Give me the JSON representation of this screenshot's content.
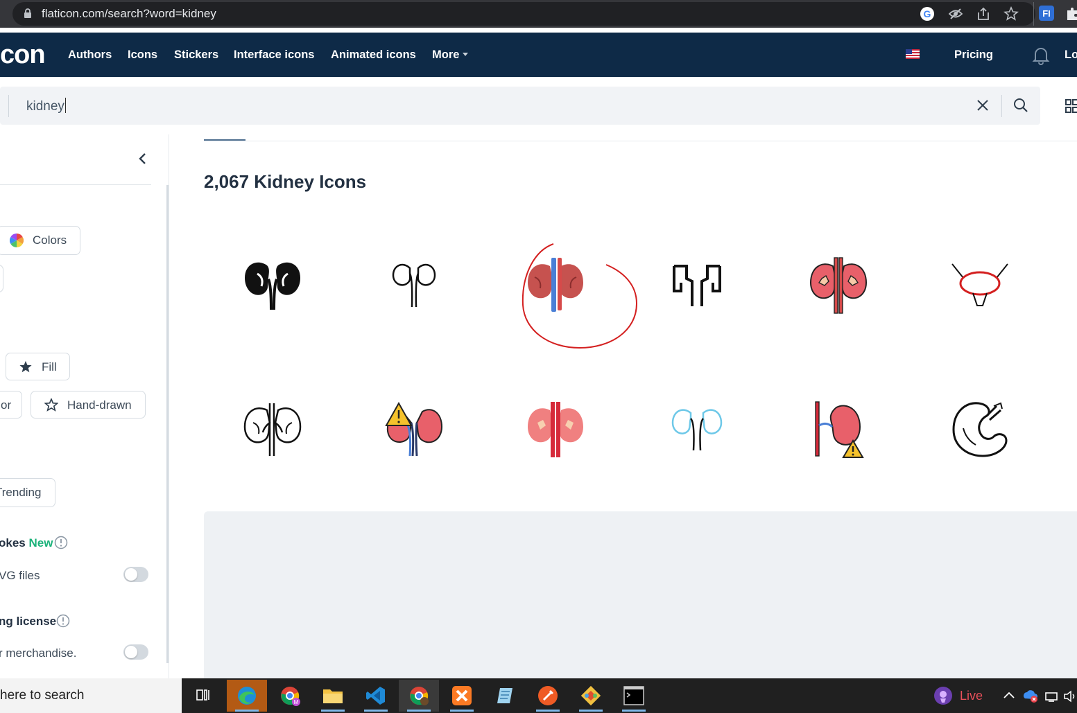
{
  "browser": {
    "url": "flaticon.com/search?word=kidney",
    "icons": [
      "google-icon",
      "eye-slash-icon",
      "share-icon",
      "star-icon",
      "flaticon-extension-icon",
      "puzzle-icon"
    ]
  },
  "header": {
    "logo_text": "con",
    "nav": [
      "Authors",
      "Icons",
      "Stickers",
      "Interface icons",
      "Animated icons",
      "More"
    ],
    "pricing_label": "Pricing",
    "login_label": "Lo"
  },
  "search": {
    "value": "kidney"
  },
  "sidebar": {
    "colors_label": "Colors",
    "fill_label": "Fill",
    "color_partial": "or",
    "handdrawn_label": "Hand-drawn",
    "trending_label": "Trending",
    "strokes_label": "okes",
    "new_badge": "New",
    "svg_label": "VG files",
    "license_label": "ng license",
    "merch_label": "r merchandise."
  },
  "main": {
    "results_title": "2,067 Kidney Icons",
    "icons": [
      "kidney-solid-black-icon",
      "kidney-outline-thin-icon",
      "kidney-red-blue-icon",
      "kidney-bold-outline-icon",
      "kidney-red-detailed-icon",
      "bladder-red-icon",
      "kidney-lineal-icon",
      "kidney-warning-icon",
      "kidney-flat-red-icon",
      "kidney-light-blue-icon",
      "kidney-half-warning-icon",
      "kidney-hand-drawn-icon"
    ]
  },
  "taskbar": {
    "search_text": "here to search",
    "live_label": "Live",
    "accent": "#7fb7e8"
  },
  "colors": {
    "header_bg": "#0e2a47",
    "accent_green": "#1bb27a",
    "kidney_red": "#e8606a",
    "vein_blue": "#4a7fd6",
    "annotation_red": "#d42020"
  }
}
